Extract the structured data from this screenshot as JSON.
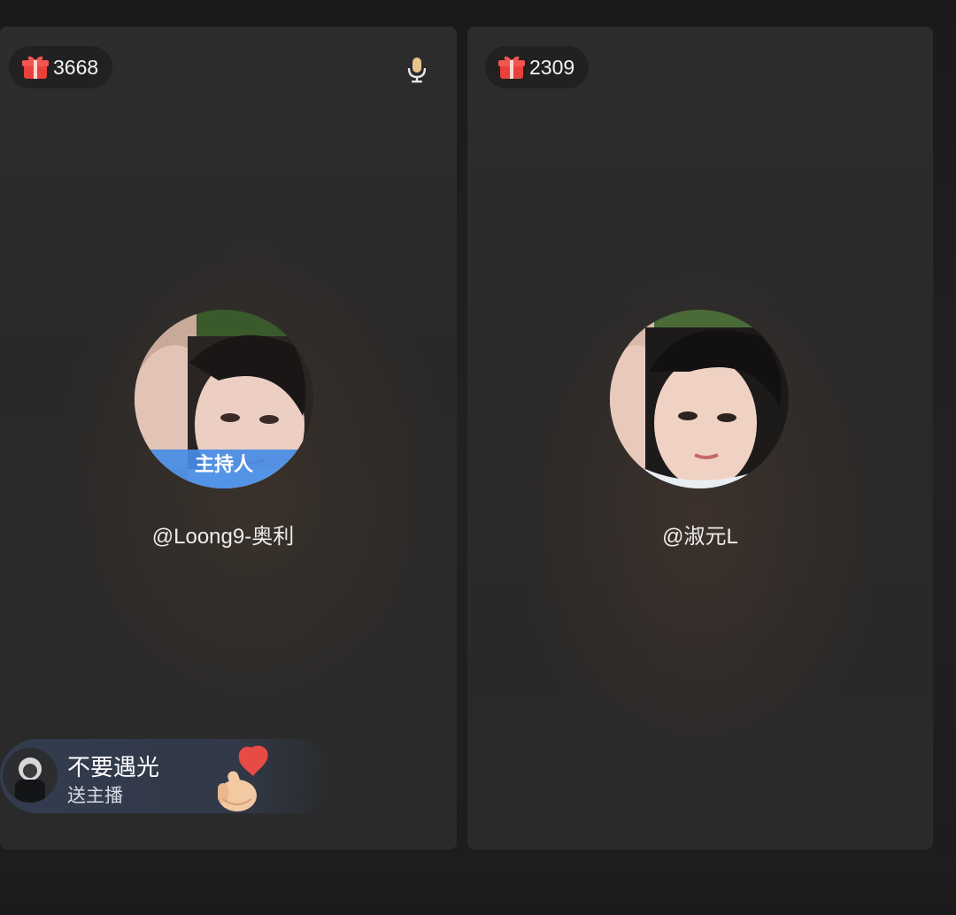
{
  "left_panel": {
    "gift_count": "3668",
    "gift_icon": "gift-box-icon",
    "mic_icon": "microphone-icon",
    "host_label": "主持人",
    "username": "@Loong9-奥利"
  },
  "right_panel": {
    "gift_count": "2309",
    "gift_icon": "gift-box-icon",
    "username": "@淑元L"
  },
  "gift_toast": {
    "sender": "不要遇光",
    "action": "送主播",
    "gift_icon": "finger-heart-icon"
  },
  "colors": {
    "host_tag": "#468ce6",
    "gift_red": "#e8413b"
  }
}
